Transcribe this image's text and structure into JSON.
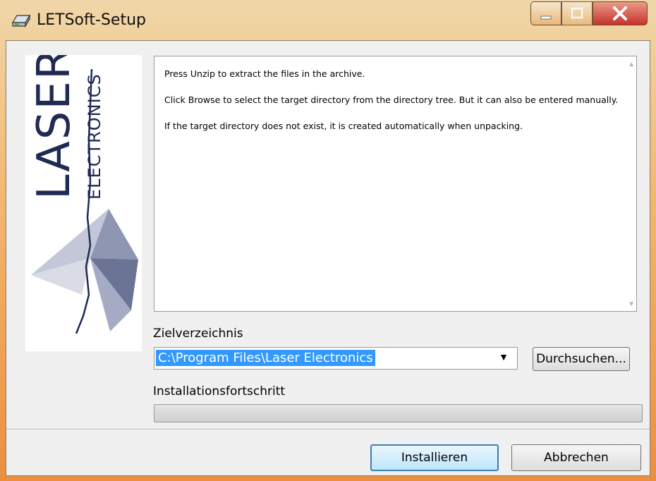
{
  "window": {
    "title": "LETSoft-Setup",
    "title_icon": "setup-drive-icon",
    "controls": {
      "minimize": "minimize-icon",
      "maximize": "maximize-icon",
      "close": "close-icon"
    }
  },
  "logo": {
    "brand": "LASER",
    "sub": "ELECTRONICS"
  },
  "instructions": [
    "Press Unzip to extract the files in the archive.",
    "Click Browse to select the target directory from the directory tree. But it can also be entered manually.",
    "If the target directory does not exist, it is created automatically when unpacking."
  ],
  "target": {
    "label": "Zielverzeichnis",
    "value": "C:\\Program Files\\Laser Electronics",
    "browse_label": "Durchsuchen..."
  },
  "progress": {
    "label": "Installationsfortschritt",
    "value": 0
  },
  "footer": {
    "install_label": "Installieren",
    "cancel_label": "Abbrechen"
  },
  "colors": {
    "selection": "#3399ff",
    "titlebar_accent": "#eb8f3f",
    "close_button": "#c6322b"
  }
}
